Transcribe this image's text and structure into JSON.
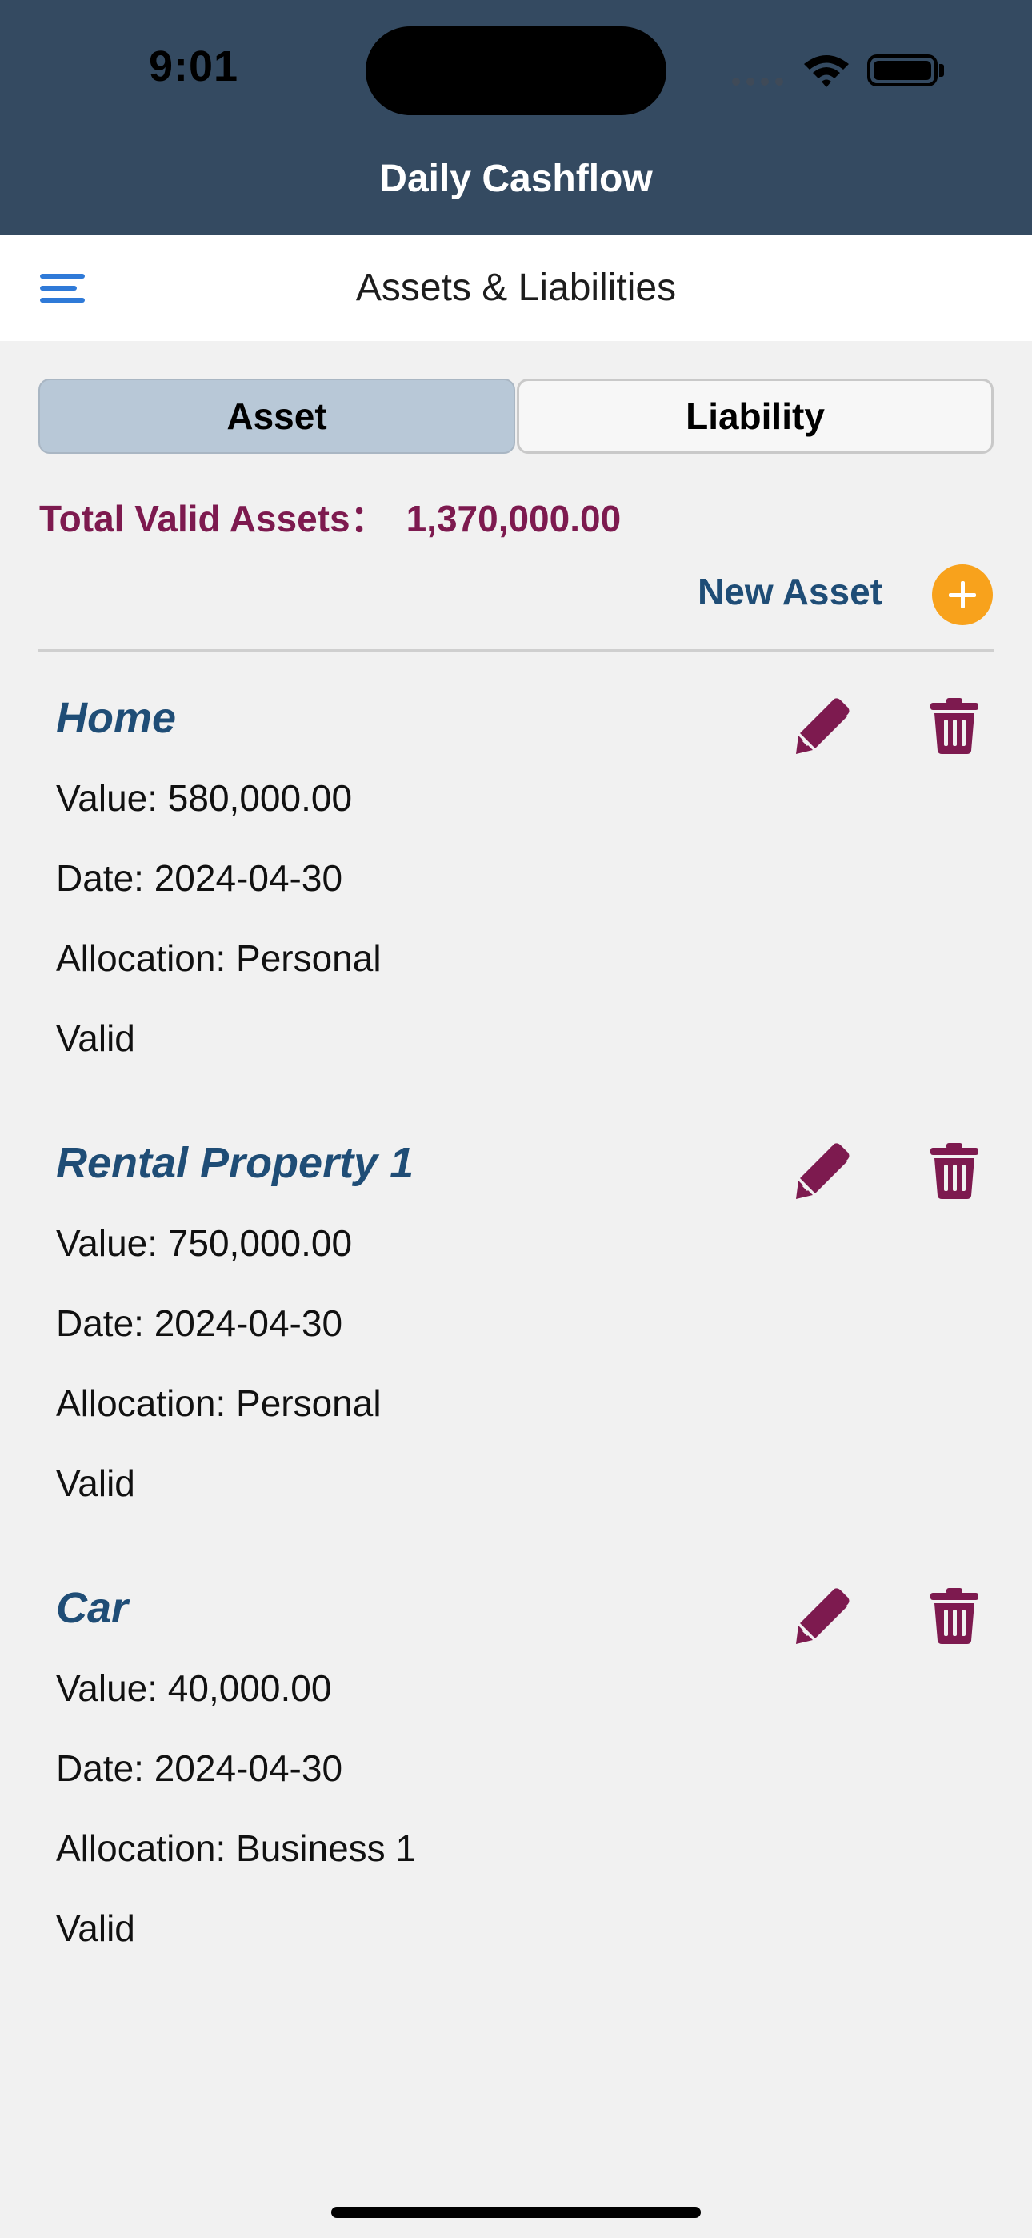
{
  "status_bar": {
    "time": "9:01"
  },
  "app": {
    "title": "Daily Cashflow"
  },
  "nav": {
    "title": "Assets & Liabilities"
  },
  "segments": {
    "asset": "Asset",
    "liability": "Liability",
    "selected": "Asset"
  },
  "summary": {
    "label": "Total Valid Assets：",
    "value": "1,370,000.00"
  },
  "actions": {
    "new_asset_label": "New Asset"
  },
  "assets": [
    {
      "name": "Home",
      "value": "Value: 580,000.00",
      "date": "Date: 2024-04-30",
      "allocation": "Allocation: Personal",
      "status": "Valid"
    },
    {
      "name": "Rental Property 1",
      "value": "Value: 750,000.00",
      "date": "Date: 2024-04-30",
      "allocation": "Allocation: Personal",
      "status": "Valid"
    },
    {
      "name": "Car",
      "value": "Value: 40,000.00",
      "date": "Date: 2024-04-30",
      "allocation": "Allocation: Business 1",
      "status": "Valid"
    }
  ],
  "colors": {
    "header_bg": "#344a61",
    "accent_maroon": "#7d1a4f",
    "accent_blue": "#1f4d76",
    "add_button": "#f8a21c",
    "segment_selected": "#b8c8d7"
  },
  "icons": [
    "menu-icon",
    "pencil-icon",
    "trash-icon",
    "plus-icon",
    "wifi-icon",
    "battery-icon"
  ]
}
